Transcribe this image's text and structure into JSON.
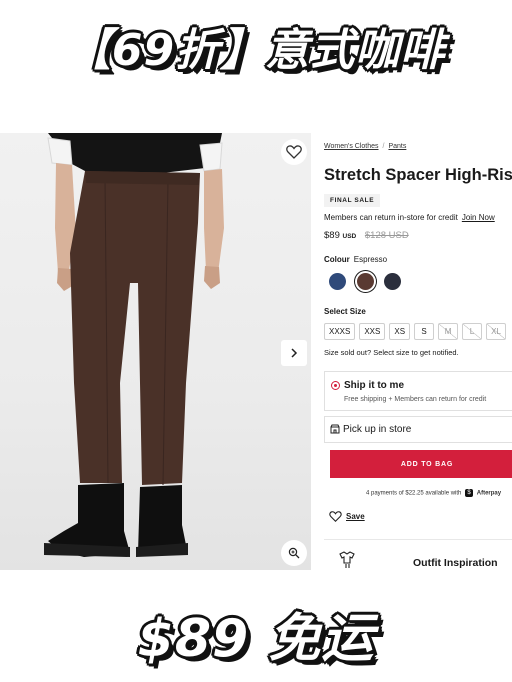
{
  "banner": {
    "top_text": "【69折】意式咖啡",
    "bottom_text": "$89 免运"
  },
  "product": {
    "breadcrumb": [
      "Women's Clothes",
      "Pants"
    ],
    "title": "Stretch Spacer High-Rise",
    "final_sale": "FINAL SALE",
    "members_text": "Members can return in-store for credit",
    "join_link": "Join Now",
    "price": "$89",
    "currency": "USD",
    "old_price": "$128 USD",
    "colour_label": "Colour",
    "colour_value": "Espresso",
    "swatches": [
      {
        "name": "navy",
        "color": "#2f4a7a",
        "selected": false
      },
      {
        "name": "espresso",
        "color": "#5a3a32",
        "selected": true
      },
      {
        "name": "dark-navy",
        "color": "#2b2f3d",
        "selected": false
      }
    ],
    "size_label": "Select Size",
    "sizes": [
      {
        "label": "XXXS",
        "sold_out": false
      },
      {
        "label": "XXS",
        "sold_out": false
      },
      {
        "label": "XS",
        "sold_out": false
      },
      {
        "label": "S",
        "sold_out": false
      },
      {
        "label": "M",
        "sold_out": true
      },
      {
        "label": "L",
        "sold_out": true
      },
      {
        "label": "XL",
        "sold_out": true
      }
    ],
    "sold_out_text": "Size sold out? Select size to get notified."
  },
  "fulfillment": {
    "ship_title": "Ship it to me",
    "ship_sub": "Free shipping + Members can return for credit",
    "pickup_title": "Pick up in store"
  },
  "actions": {
    "add_to_bag": "ADD TO BAG",
    "afterpay_text": "4 payments of $22.25 available with",
    "afterpay_brand": "Afterpay",
    "save": "Save",
    "outfit": "Outfit Inspiration"
  },
  "colors": {
    "accent": "#d31f3c",
    "pants": "#4a3128"
  }
}
